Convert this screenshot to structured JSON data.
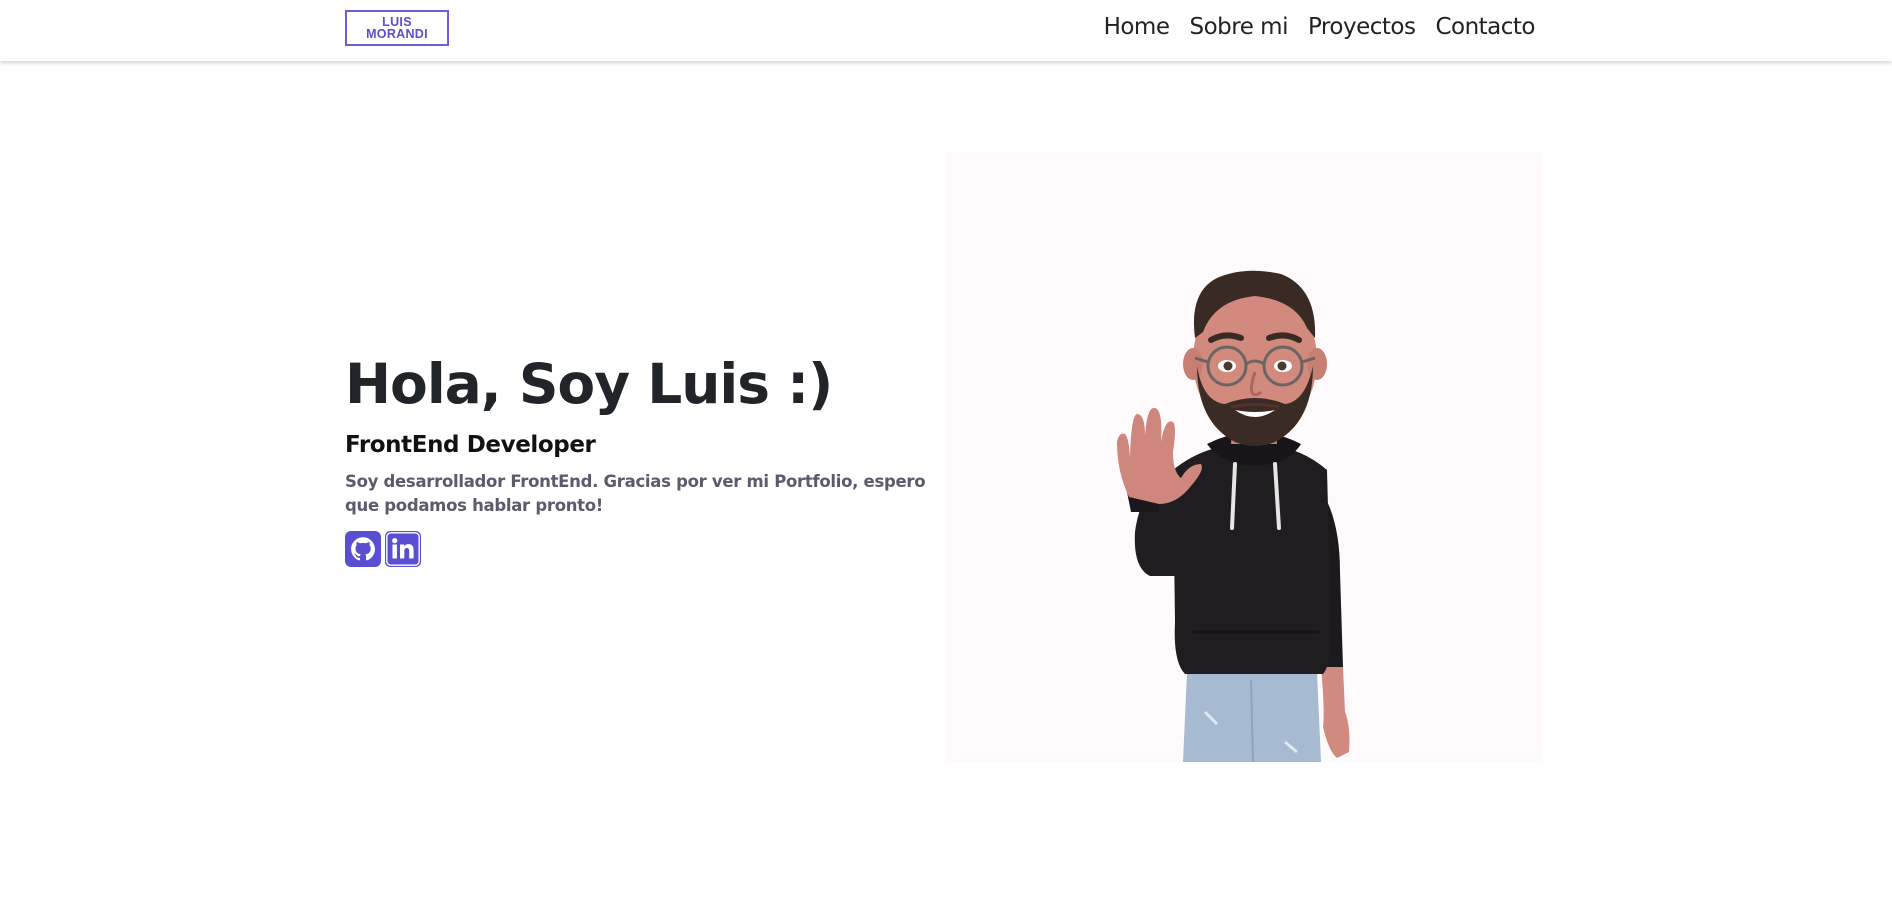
{
  "logo": {
    "line1": "LUIS",
    "line2": "MORANDI"
  },
  "nav": {
    "items": [
      {
        "label": "Home"
      },
      {
        "label": "Sobre mi"
      },
      {
        "label": "Proyectos"
      },
      {
        "label": "Contacto"
      }
    ]
  },
  "hero": {
    "title": "Hola, Soy Luis :)",
    "subtitle": "FrontEnd Developer",
    "description": "Soy desarrollador FrontEnd. Gracias por ver mi Portfolio, espero que podamos hablar pronto!"
  },
  "social": {
    "links": [
      {
        "icon": "github-icon"
      },
      {
        "icon": "linkedin-icon"
      }
    ]
  },
  "avatar": {
    "description_icon": "waving-avatar-illustration"
  },
  "colors": {
    "accent": "#5a4fd0",
    "text_dark": "#212529",
    "text_muted": "#5c5a6c",
    "hoodie": "#1f1d1f",
    "jeans": "#9fb6d0"
  }
}
